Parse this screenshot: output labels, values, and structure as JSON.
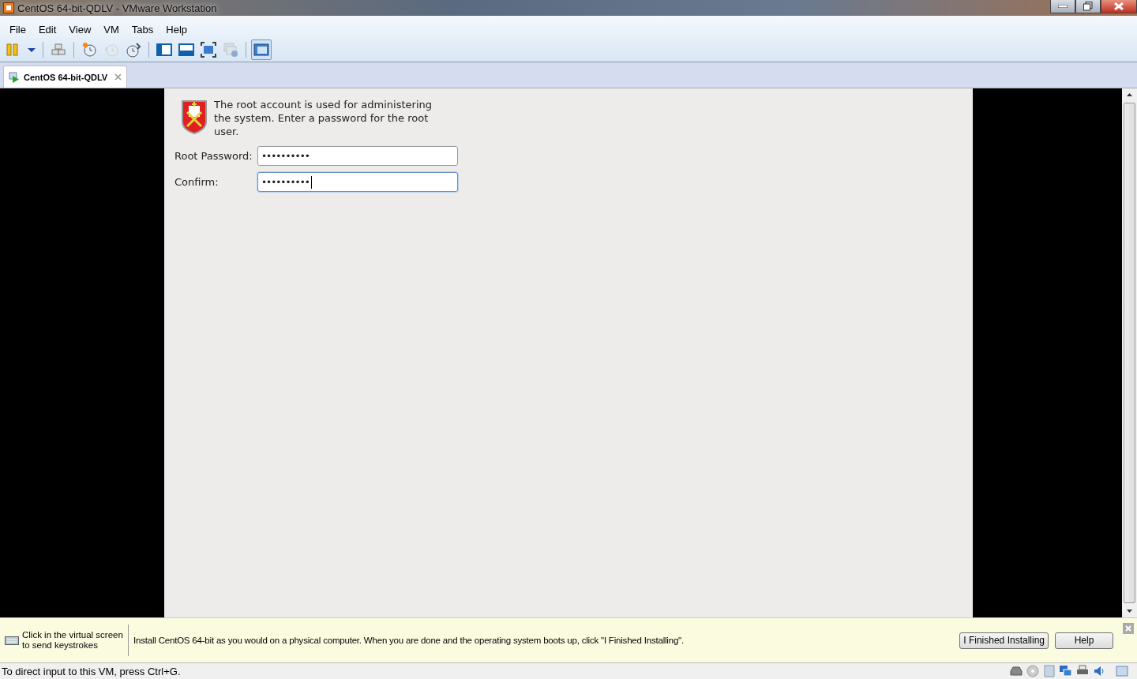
{
  "window": {
    "title": "CentOS 64-bit-QDLV - VMware Workstation"
  },
  "menu": [
    "File",
    "Edit",
    "View",
    "VM",
    "Tabs",
    "Help"
  ],
  "toolbar": [
    {
      "kind": "pause",
      "disabled": false,
      "pressed": false
    },
    {
      "kind": "dropdown",
      "disabled": false,
      "pressed": false
    },
    {
      "kind": "sep"
    },
    {
      "kind": "keys",
      "disabled": false,
      "pressed": false
    },
    {
      "kind": "sep"
    },
    {
      "kind": "snapshot",
      "disabled": false,
      "pressed": false
    },
    {
      "kind": "revert",
      "disabled": true,
      "pressed": false
    },
    {
      "kind": "manage",
      "disabled": false,
      "pressed": false
    },
    {
      "kind": "sep"
    },
    {
      "kind": "sidebar",
      "disabled": false,
      "pressed": false
    },
    {
      "kind": "thumbs",
      "disabled": false,
      "pressed": false
    },
    {
      "kind": "fullscreen",
      "disabled": false,
      "pressed": false
    },
    {
      "kind": "unity",
      "disabled": true,
      "pressed": false
    },
    {
      "kind": "sep"
    },
    {
      "kind": "console",
      "disabled": false,
      "pressed": true
    }
  ],
  "tabs": [
    {
      "label": "CentOS 64-bit-QDLV",
      "selected": true
    }
  ],
  "installer": {
    "message": "The root account is used for administering the system.  Enter a password for the root user.",
    "fields": [
      {
        "label": "Root Password:",
        "value": "••••••••••",
        "focused": false
      },
      {
        "label": "Confirm:",
        "value": "••••••••••",
        "focused": true
      }
    ]
  },
  "hint_bar": {
    "tip": "Click in the virtual screen to send keystrokes",
    "message": "Install CentOS 64-bit as you would on a physical computer. When you are done and the operating system boots up, click \"I Finished Installing\".",
    "buttons": [
      "I Finished Installing",
      "Help"
    ]
  },
  "status_bar": {
    "text": "To direct input to this VM, press Ctrl+G."
  }
}
